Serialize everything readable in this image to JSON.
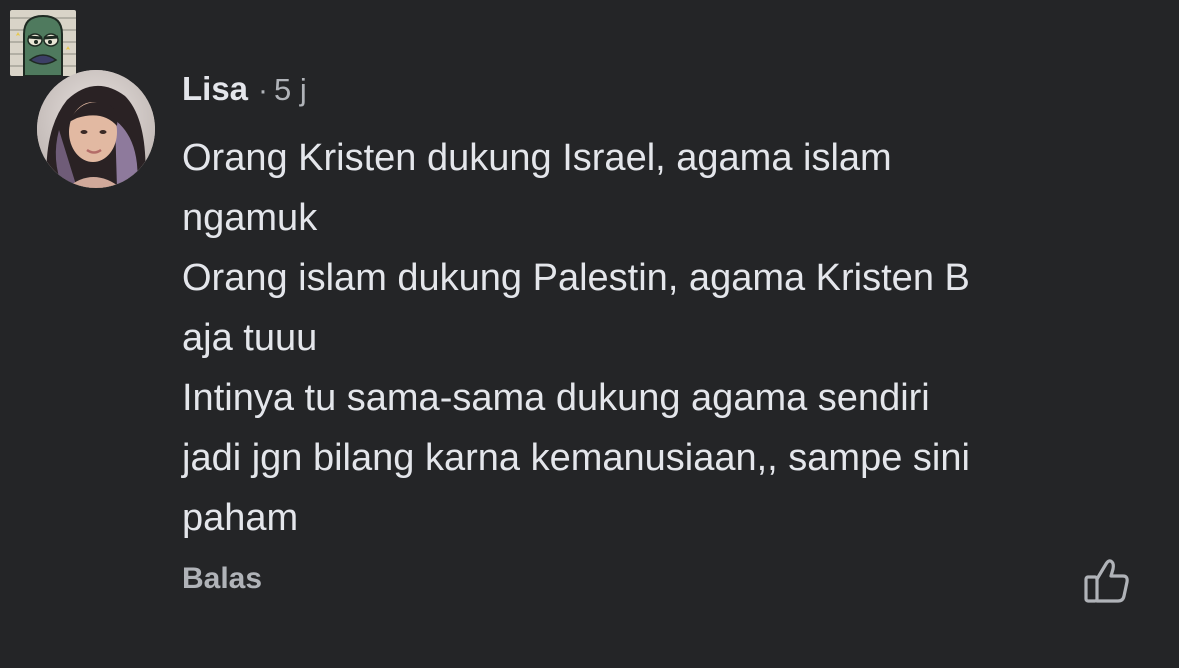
{
  "comment": {
    "author": "Lisa",
    "separator": "·",
    "timestamp": "5 j",
    "lines": [
      "Orang Kristen dukung Israel, agama islam",
      "ngamuk",
      "Orang islam dukung Palestin, agama Kristen B",
      "aja tuuu",
      "Intinya tu sama-sama dukung agama sendiri",
      "jadi jgn bilang karna kemanusiaan,, sampe sini",
      "paham"
    ],
    "reply_label": "Balas"
  },
  "icons": {
    "like": "thumbs-up-icon",
    "parent_avatar": "cartoon-avatar",
    "avatar": "profile-photo"
  }
}
